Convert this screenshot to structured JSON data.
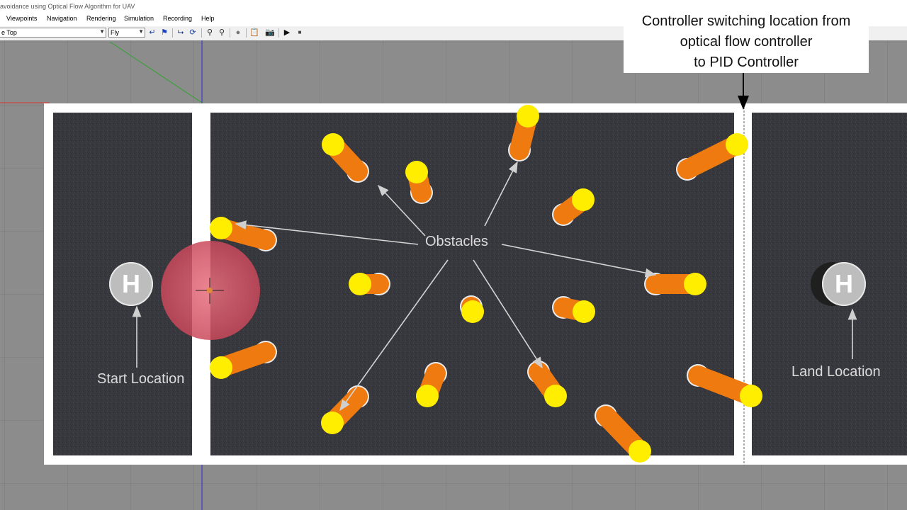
{
  "window": {
    "title": "avoidance using  Optical Flow Algorithm for UAV"
  },
  "menu": [
    "Viewpoints",
    "Navigation",
    "Rendering",
    "Simulation",
    "Recording",
    "Help"
  ],
  "toolbar": {
    "viewpoint_value": "e Top",
    "navigation_value": "Fly",
    "icons": [
      "undo-arrow-icon",
      "flag-icon",
      "align-icon",
      "refresh-icon",
      "zoom-in-icon",
      "zoom-out-icon",
      "record-icon",
      "clipboard-icon",
      "camera-icon",
      "play-icon",
      "stop-icon"
    ]
  },
  "scene": {
    "obstacles_label": "Obstacles",
    "start_label": "Start Location",
    "land_label": "Land Location",
    "helipad_letter": "H"
  },
  "callout": {
    "lines": [
      "Controller switching location from",
      "optical flow  controller",
      "to PID Controller"
    ]
  },
  "colors": {
    "obstacle_body": "#ee7a10",
    "obstacle_cap": "#ffee00",
    "ground": "#36363d",
    "frame": "#ffffff",
    "start_zone": "#e0304a",
    "annotation": "#d9d9d9",
    "grid": "#8c8c8c"
  }
}
